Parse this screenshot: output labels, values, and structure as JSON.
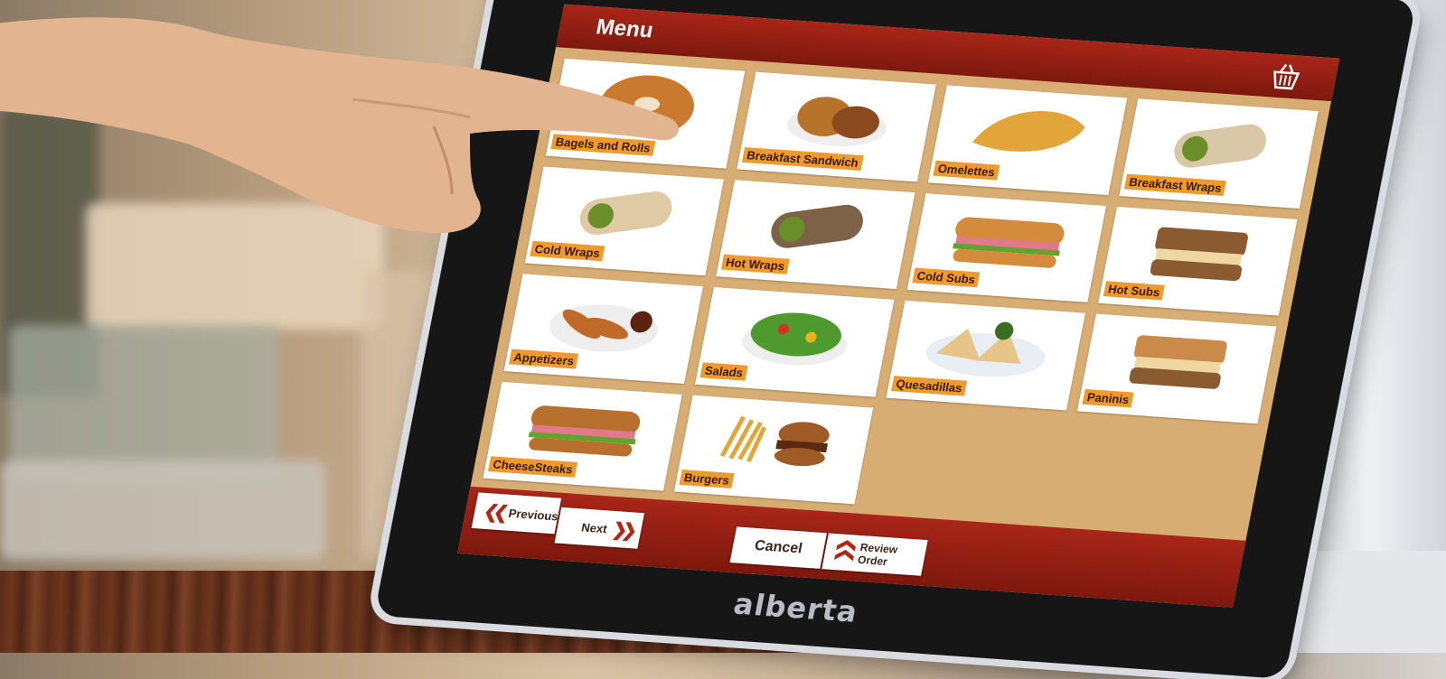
{
  "app": {
    "title": "Menu",
    "brand": "alberta"
  },
  "header": {
    "cart_icon": "basket-icon"
  },
  "menu": {
    "items": [
      {
        "label": "Bagels and Rolls",
        "icon": "bagel",
        "color": "#c97a2e"
      },
      {
        "label": "Breakfast Sandwich",
        "icon": "sandwich",
        "color": "#b8732b"
      },
      {
        "label": "Omelettes",
        "icon": "omelette",
        "color": "#e2a53a"
      },
      {
        "label": "Breakfast Wraps",
        "icon": "wrap",
        "color": "#d9c8a8"
      },
      {
        "label": "Cold Wraps",
        "icon": "wrap",
        "color": "#e0c9a5"
      },
      {
        "label": "Hot Wraps",
        "icon": "wrap",
        "color": "#7d6247"
      },
      {
        "label": "Cold Subs",
        "icon": "sub",
        "color": "#d48c3c"
      },
      {
        "label": "Hot Subs",
        "icon": "panini",
        "color": "#8a5a31"
      },
      {
        "label": "Appetizers",
        "icon": "tenders",
        "color": "#c0692b"
      },
      {
        "label": "Salads",
        "icon": "salad",
        "color": "#4f9a2e"
      },
      {
        "label": "Quesadillas",
        "icon": "quesadilla",
        "color": "#e7c48a"
      },
      {
        "label": "Paninis",
        "icon": "panini",
        "color": "#c98a4a"
      },
      {
        "label": "CheeseSteaks",
        "icon": "sub",
        "color": "#b8702e"
      },
      {
        "label": "Burgers",
        "icon": "burger",
        "color": "#a05a25"
      }
    ]
  },
  "footer": {
    "previous_label": "Previous",
    "next_label": "Next",
    "cancel_label": "Cancel",
    "review_label": "Review Order"
  },
  "colors": {
    "accent": "#a82618",
    "panel": "#d7ad74",
    "label_bg": "#ee9a2e"
  }
}
